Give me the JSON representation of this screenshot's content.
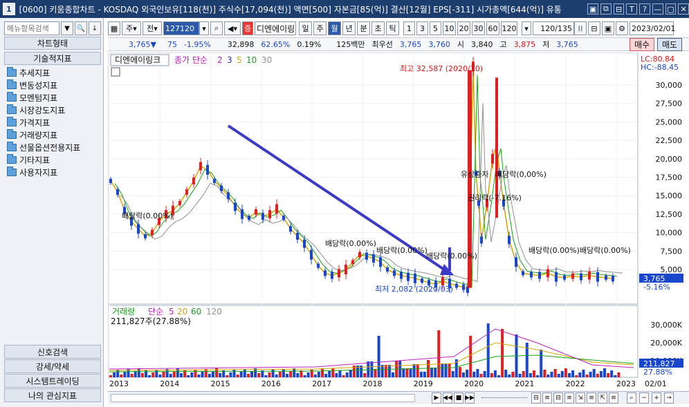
{
  "window": {
    "badge": "1",
    "title": "[0600] 키움종합차트 - KOSDAQ 외국인보유[118(천)] 주식수[17,094(천)] 액면[500] 자본금[85(억)] 결산[12월] EPS[-311] 시가총액[644(억)] 유통",
    "buttons": [
      "▣",
      "⧉",
      "⊟",
      "T",
      "?",
      "—",
      "▢",
      "✕"
    ]
  },
  "left_panel": {
    "search_placeholder": "메뉴항목검색",
    "search_btn": "🔍",
    "download_btn": "↓",
    "header1": "차트형태",
    "header2": "기술적지표",
    "tree": [
      "추세지표",
      "변동성지표",
      "모멘텀지표",
      "시장강도지표",
      "가격지표",
      "거래량지표",
      "선물옵션전용지표",
      "기타지표",
      "사용자지표"
    ],
    "bottom": [
      "신호검색",
      "강세/약세",
      "시스템트레이딩",
      "나의 관심지표"
    ]
  },
  "toolbar": {
    "week_label": "주",
    "prev_label": "전",
    "code": "127120",
    "stock_name": "디엔에이링",
    "jeung": "증",
    "periods": [
      "일",
      "주",
      "월",
      "년",
      "분",
      "초",
      "틱"
    ],
    "active_period": "월",
    "numbers": [
      "1",
      "3",
      "5",
      "10",
      "20",
      "30",
      "60",
      "120"
    ],
    "count": "120/135",
    "date": "2023/02/01"
  },
  "quote": {
    "price": "3,765▼",
    "change": "75",
    "pct": "-1.95%",
    "volume": "32,898",
    "turnover_pct": "62.65%",
    "ratio": "0.19%",
    "amount": "125백만",
    "best_label": "최우선",
    "best_ask": "3,765",
    "best_bid": "3,760",
    "open_label": "시",
    "open": "3,840",
    "high_label": "고",
    "high": "3,875",
    "low_label": "저",
    "low": "3,765",
    "buy": "매수",
    "sell": "매도"
  },
  "chart": {
    "name_tag": "디엔에이링크",
    "legend_prefix": "종가 단순",
    "ma_labels": [
      "2",
      "3",
      "5",
      "10",
      "30"
    ],
    "ma_colors": [
      "#c020c0",
      "#2a2ad0",
      "#d4a400",
      "#16a016",
      "#909090"
    ],
    "lc": "LC:80.84",
    "hc": "HC:-88.45",
    "price_axis": [
      "30,000",
      "27,500",
      "25,000",
      "22,500",
      "20,000",
      "17,500",
      "15,000",
      "12,500",
      "10,000",
      "7,500",
      "5,000"
    ],
    "price_tag": "3,765",
    "pct_tag": "-5.16%",
    "annotations": {
      "high": "최고 32,587 (2020/10)",
      "low": "최저 2,082 (2020/03)",
      "div1": "배당락(0.00%)",
      "div2": "배당락(0.00%)",
      "div3": "배당락(0.00%)",
      "div4": "배당락(0.00%)",
      "div5": "배당락(0.00%)",
      "div6": "배당락(0.00%)",
      "rights": "유상증자",
      "div7": "배당락(0,00%)",
      "free": "권리락(-7.16%)"
    }
  },
  "volume": {
    "legend_prefix": "거래량",
    "legend_type": "단순",
    "ma_labels": [
      "5",
      "20",
      "60",
      "120"
    ],
    "ma_colors": [
      "#c020c0",
      "#d4a400",
      "#16a016",
      "#909090"
    ],
    "value_line": "211,827주(27.88%)",
    "axis": [
      "30,000K",
      "20,000K",
      "10,000K"
    ],
    "tag": "211,827",
    "tag_pct": "27.88%"
  },
  "x_axis": [
    "2013",
    "2014",
    "2015",
    "2016",
    "2017",
    "2018",
    "2019",
    "2020",
    "2021",
    "2022",
    "2023",
    "02/01"
  ]
}
